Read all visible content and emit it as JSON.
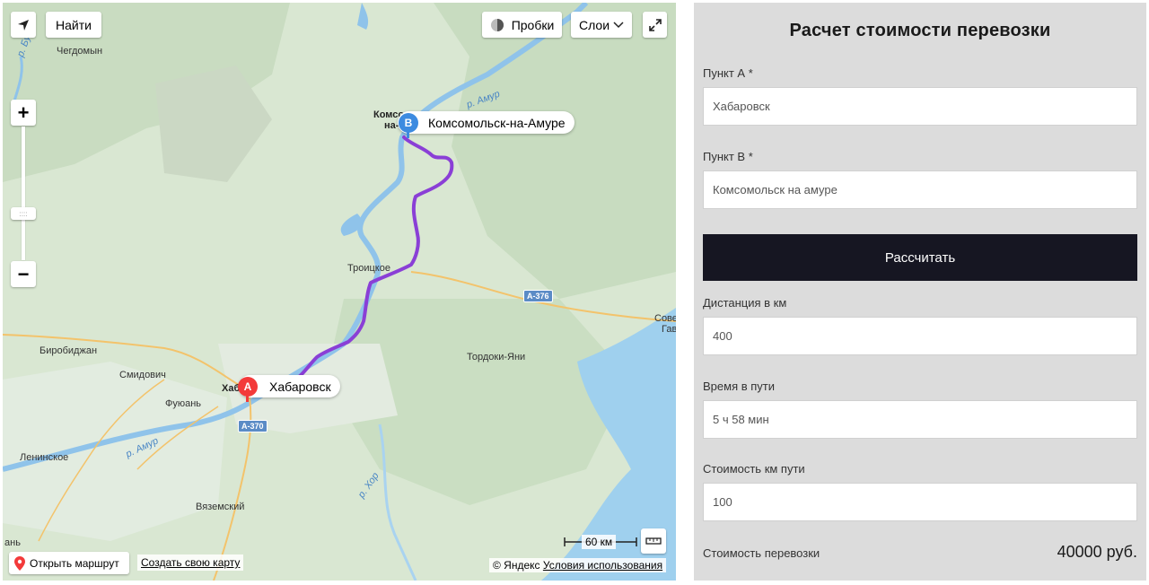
{
  "map": {
    "find_label": "Найти",
    "traffic_label": "Пробки",
    "layers_label": "Слои",
    "pin_b": {
      "letter": "B",
      "label": "Комсомольск-на-Амуре"
    },
    "pin_a": {
      "letter": "A",
      "label": "Хабаровск"
    },
    "route_label": "Открыть маршрут",
    "create_map_label": "Создать свою карту",
    "copyright_prefix": "© Яндекс",
    "terms_label": "Условия использования",
    "scale_label": "60 км",
    "place_labels": [
      "Чегдомын",
      "Биробиджан",
      "Смидович",
      "Фуюань",
      "Ленинское",
      "Вяземский",
      "Троицкое",
      "Тордоки-Яни",
      "Хаб",
      "Комсо",
      "на-",
      "Сове",
      "Гав",
      "ань"
    ],
    "river_labels": [
      "р. Бурея",
      "р. Амур",
      "р. Амур",
      "р. Хор"
    ],
    "road_labels": [
      "А-376",
      "А-370"
    ],
    "route_color": "#8a3fd6"
  },
  "calculator": {
    "title": "Расчет стоимости перевозки",
    "point_a_label": "Пункт А *",
    "point_a_value": "Хабаровск",
    "point_b_label": "Пункт B *",
    "point_b_value": "Комсомольск на амуре",
    "calc_button": "Рассчитать",
    "distance_label": "Дистанция в км",
    "distance_value": "400",
    "time_label": "Время в пути",
    "time_value": "5 ч 58 мин",
    "rate_label": "Стоимость км пути",
    "rate_value": "100",
    "total_label": "Стоимость перевозки",
    "total_value": "40000 руб.",
    "button_color": "#161622",
    "panel_bg": "#dcdcdc"
  }
}
